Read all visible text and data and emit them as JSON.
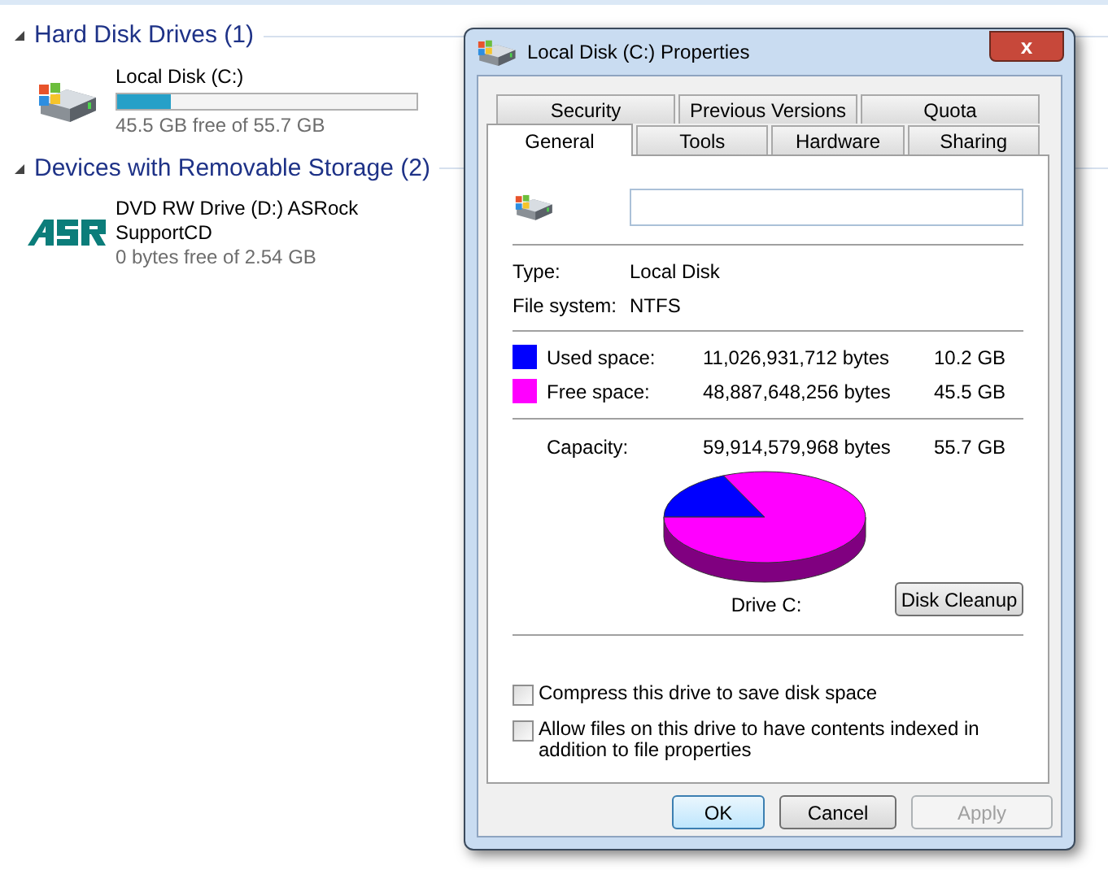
{
  "explorer": {
    "groups": [
      {
        "title": "Hard Disk Drives (1)",
        "drives": [
          {
            "kind": "disk",
            "name": "Local Disk (C:)",
            "level": 0.18,
            "detail": "45.5 GB free of 55.7 GB"
          }
        ]
      },
      {
        "title": "Devices with Removable Storage (2)",
        "drives": [
          {
            "kind": "optical",
            "name": "DVD RW Drive (D:) ASRock SupportCD",
            "detail": "0 bytes free of 2.54 GB"
          }
        ]
      }
    ]
  },
  "dialog": {
    "title": "Local Disk (C:) Properties",
    "close": "x",
    "tab_rows": [
      [
        {
          "label": "Security",
          "selected": false
        },
        {
          "label": "Previous Versions",
          "selected": false
        },
        {
          "label": "Quota",
          "selected": false
        }
      ],
      [
        {
          "label": "General",
          "selected": true
        },
        {
          "label": "Tools",
          "selected": false
        },
        {
          "label": "Hardware",
          "selected": false
        },
        {
          "label": "Sharing",
          "selected": false
        }
      ]
    ],
    "general": {
      "info": [
        {
          "label": "Type:",
          "value": "Local Disk"
        },
        {
          "label": "File system:",
          "value": "NTFS"
        }
      ],
      "space": [
        {
          "label": "Used space:",
          "bytes": "11,026,931,712 bytes",
          "size": "10.2 GB",
          "color": "#0000ff"
        },
        {
          "label": "Free space:",
          "bytes": "48,887,648,256 bytes",
          "size": "45.5 GB",
          "color": "#ff00ff"
        }
      ],
      "capacity": {
        "label": "Capacity:",
        "bytes": "59,914,579,968 bytes",
        "size": "55.7 GB"
      },
      "drive_label": "Drive C:",
      "cleanup_button": "Disk Cleanup",
      "options": [
        {
          "label": "Compress this drive to save disk space",
          "checked": false
        },
        {
          "label": "Allow files on this drive to have contents indexed in addition to file properties",
          "checked": false
        }
      ]
    },
    "buttons": [
      {
        "label": "OK",
        "kind": "default"
      },
      {
        "label": "Cancel",
        "kind": "normal"
      },
      {
        "label": "Apply",
        "kind": "disabled"
      }
    ]
  }
}
